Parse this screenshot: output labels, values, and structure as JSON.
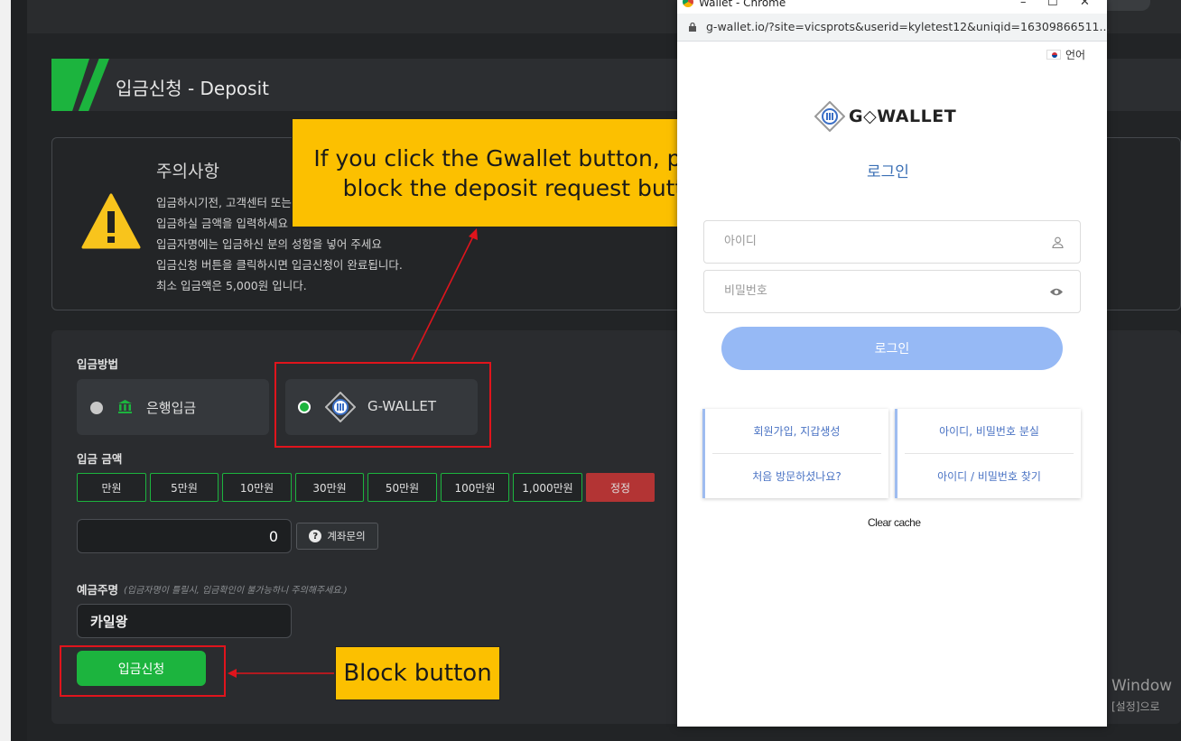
{
  "page": {
    "title": "입금신청 - Deposit",
    "notice_title": "주의사항",
    "notice_lines": [
      "입금하시기전, 고객센터 또는",
      "입금하실 금액을 입력하세요",
      "입금자명에는 입금하신 분의 성함을 넣어 주세요",
      "입금신청 버튼을 클릭하시면 입금신청이 완료됩니다.",
      "최소 입금액은 5,000원 입니다."
    ]
  },
  "form": {
    "method_label": "입금방법",
    "methods": [
      {
        "label": "은행입금",
        "selected": false,
        "icon": "bank-icon"
      },
      {
        "label": "G-WALLET",
        "selected": true,
        "icon": "gwallet-logo-icon"
      }
    ],
    "amount_label": "입금 금액",
    "amount_buttons": [
      "만원",
      "5만원",
      "10만원",
      "30만원",
      "50만원",
      "100만원",
      "1,000만원",
      "정정"
    ],
    "amount_value": "0",
    "account_inquiry": "계좌문의",
    "depositor_label": "예금주명",
    "depositor_note": "(입금자명이 틀릴시, 입금확인이 불가능하니 주의해주세요.)",
    "depositor_value": "카일왕",
    "submit_label": "입금신청"
  },
  "annotations": {
    "callout_top": "If you click the Gwallet button, please block the  deposit request button",
    "callout_bottom": "Block button",
    "color": "#e0141c"
  },
  "popup": {
    "window_title": "Wallet - Chrome",
    "url": "g-wallet.io/?site=vicsprots&userid=kyletest12&uniqid=16309866511...",
    "language": "언어",
    "logo_text": "G◇WALLET",
    "login_title": "로그인",
    "id_placeholder": "아이디",
    "password_placeholder": "비밀번호",
    "login_button": "로그인",
    "card_left": [
      "회원가입, 지갑생성",
      "처음 방문하셨나요?"
    ],
    "card_right": [
      "아이디, 비밀번호 분실",
      "아이디 / 비밀번호 찾기"
    ],
    "clear_cache": "Clear cache"
  },
  "watermark": [
    "Window",
    "[설정]으로"
  ]
}
